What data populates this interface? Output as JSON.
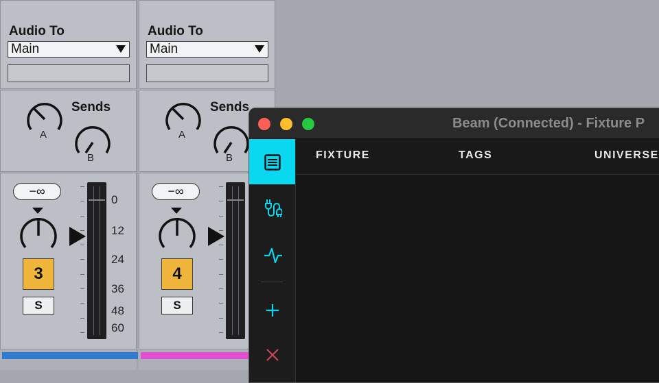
{
  "mixer": {
    "tracks": [
      {
        "audio_to_label": "Audio To",
        "output": "Main",
        "sends_label": "Sends",
        "send_a": "A",
        "send_b": "B",
        "volume": "−∞",
        "track_number": "3",
        "solo_label": "S",
        "color": "#2f7bd0"
      },
      {
        "audio_to_label": "Audio To",
        "output": "Main",
        "sends_label": "Sends",
        "send_a": "A",
        "send_b": "B",
        "volume": "−∞",
        "track_number": "4",
        "solo_label": "S",
        "color": "#e34fd2"
      }
    ],
    "meter_scale": [
      "0",
      "12",
      "24",
      "36",
      "48",
      "60"
    ]
  },
  "beam": {
    "title": "Beam (Connected) - Fixture P",
    "traffic_lights": [
      "#fe5f57",
      "#febc2e",
      "#28c840"
    ],
    "accent": "#0ad8f0",
    "sidebar": [
      {
        "icon": "list-icon",
        "active": true
      },
      {
        "icon": "plug-cable-icon",
        "active": false
      },
      {
        "icon": "waveform-icon",
        "active": false
      },
      {
        "icon": "plus-icon",
        "active": false
      },
      {
        "icon": "close-icon",
        "active": false
      }
    ],
    "columns": [
      "FIXTURE",
      "TAGS",
      "UNIVERSE"
    ]
  }
}
